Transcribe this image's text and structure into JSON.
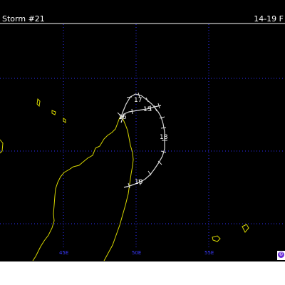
{
  "header": {
    "title_left": "Storm #21",
    "title_right": "14-19 F"
  },
  "longitude_labels": [
    "45E",
    "50E",
    "55E"
  ],
  "day_labels": [
    "17",
    "16",
    "15",
    "18",
    "19"
  ],
  "logo": {
    "glyph": "©",
    "color": "#6a2bd8"
  },
  "colors": {
    "background": "#000000",
    "grid": "#3030ff",
    "coastline": "#d8d800",
    "track": "#d9d9d9"
  }
}
